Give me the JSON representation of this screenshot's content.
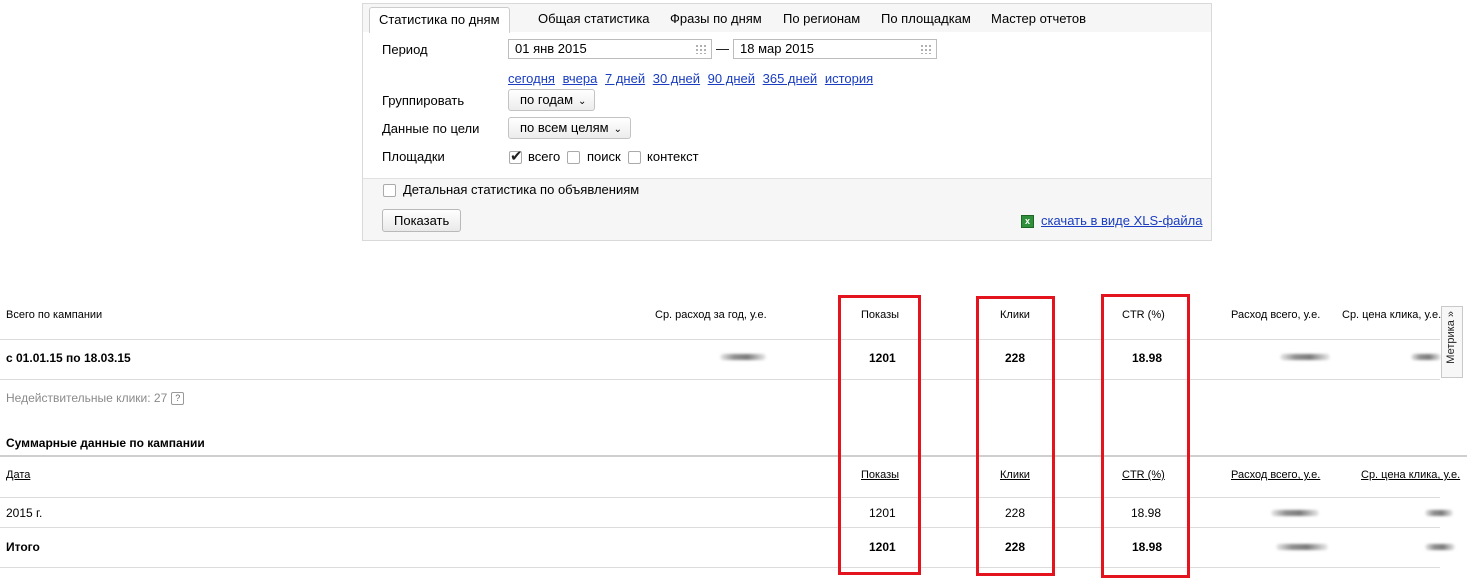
{
  "tabs": [
    {
      "label": "Статистика по дням",
      "active": true
    },
    {
      "label": "Общая статистика"
    },
    {
      "label": "Фразы по дням"
    },
    {
      "label": "По регионам"
    },
    {
      "label": "По площадкам"
    },
    {
      "label": "Мастер отчетов"
    }
  ],
  "form": {
    "period_label": "Период",
    "date_from": "01 янв 2015",
    "date_separator": "—",
    "date_to": "18 мар 2015",
    "quick_links": [
      "сегодня",
      "вчера",
      "7 дней",
      "30 дней",
      "90 дней",
      "365 дней",
      "история"
    ],
    "group_label": "Группировать",
    "group_value": "по годам",
    "goal_label": "Данные по цели",
    "goal_value": "по всем целям",
    "platforms_label": "Площадки",
    "platforms": [
      {
        "label": "всего",
        "checked": true
      },
      {
        "label": "поиск",
        "checked": false
      },
      {
        "label": "контекст",
        "checked": false
      }
    ],
    "detailed_label": "Детальная статистика по объявлениям",
    "detailed_checked": false,
    "show_button": "Показать",
    "xls_link": "скачать в виде XLS-файла"
  },
  "summary": {
    "headers": {
      "total": "Всего по кампании",
      "avg_spend": "Ср. расход за год, у.е.",
      "impressions": "Показы",
      "clicks": "Клики",
      "ctr": "CTR (%)",
      "spend_total": "Расход всего, у.е.",
      "avg_cpc": "Ср. цена клика, у.е."
    },
    "row": {
      "period": "с 01.01.15 по 18.03.15",
      "impressions": "1201",
      "clicks": "228",
      "ctr": "18.98"
    },
    "invalid_clicks": "Недействительные клики: 27",
    "help_icon": "?",
    "metrika": "Метрика »"
  },
  "campaign": {
    "title": "Суммарные данные по кампании",
    "headers": {
      "date": "Дата",
      "impressions": "Показы",
      "clicks": "Клики",
      "ctr": "CTR (%)",
      "spend_total": "Расход всего, у.е.",
      "avg_cpc": "Ср. цена клика, у.е."
    },
    "rows": [
      {
        "date": "2015 г.",
        "impressions": "1201",
        "clicks": "228",
        "ctr": "18.98"
      },
      {
        "date": "Итого",
        "impressions": "1201",
        "clicks": "228",
        "ctr": "18.98"
      }
    ]
  },
  "colors": {
    "highlight": "#e4141f",
    "link": "#1a3dc1"
  }
}
